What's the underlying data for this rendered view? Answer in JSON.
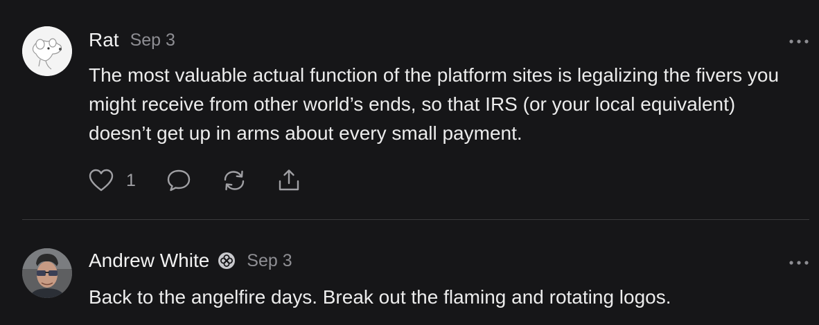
{
  "posts": [
    {
      "author": "Rat",
      "date": "Sep 3",
      "avatar_icon": "rat-avatar-icon",
      "body": "The most valuable actual function of the platform sites is legalizing the fivers you might receive from other world’s ends, so that IRS (or your local equivalent) doesn’t get up in arms about every small payment.",
      "like_count": "1",
      "actions": [
        "heart-icon",
        "comment-icon",
        "repost-icon",
        "share-icon"
      ]
    },
    {
      "author": "Andrew White",
      "date": "Sep 3",
      "avatar_icon": "person-avatar-icon",
      "badge_icon": "verified-badge-icon",
      "body": "Back to the angelfire days. Break out the flaming and rotating logos."
    }
  ],
  "colors": {
    "background": "#161618",
    "text": "#ececec",
    "muted": "#8e8e93",
    "divider": "#3a3a3c"
  }
}
